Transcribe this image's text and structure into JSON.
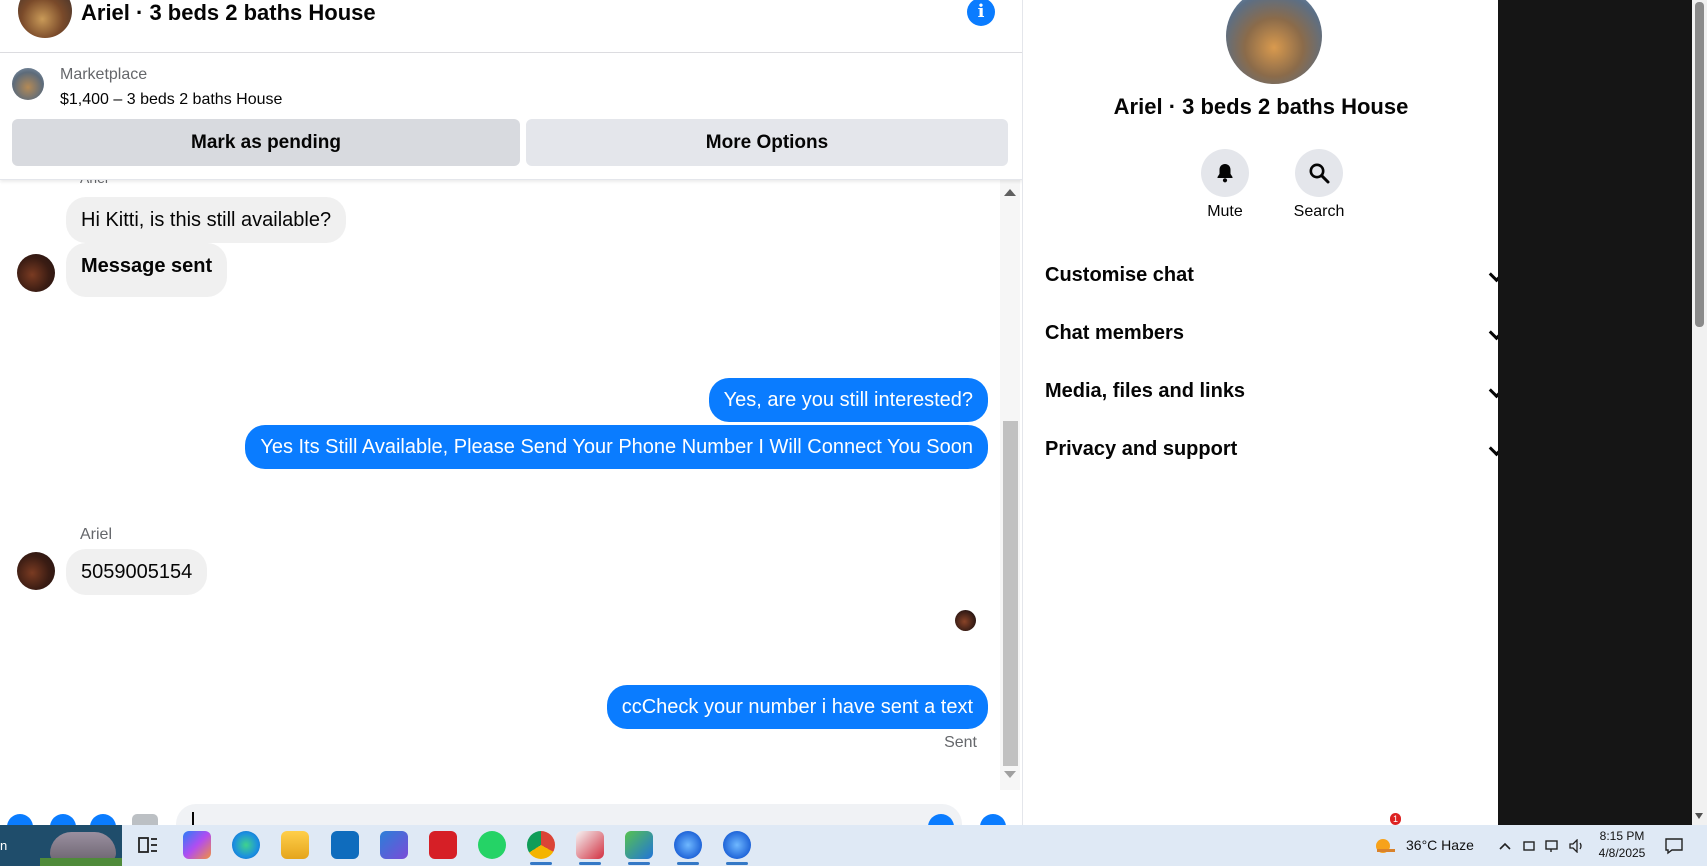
{
  "header": {
    "title": "Ariel · 3 beds 2 baths House"
  },
  "listing": {
    "source": "Marketplace",
    "price_line": "$1,400 – 3 beds 2 baths House",
    "pending_label": "Mark as pending",
    "more_label": "More Options"
  },
  "messages": {
    "cut_sender": "Ariel",
    "in_1": "Hi Kitti, is this still available?",
    "in_2": "Message sent",
    "out_1": "Yes, are you still interested?",
    "out_2": "Yes Its Still Available, Please Send Your Phone Number I Will Connect You Soon",
    "sender_2": "Ariel",
    "in_3": "5059005154",
    "out_3": "ccCheck your number i have sent a text",
    "status": "Sent"
  },
  "details": {
    "name": "Ariel · 3 beds 2 baths House",
    "mute_label": "Mute",
    "search_label": "Search",
    "sections": [
      "Customise chat",
      "Chat members",
      "Media, files and links",
      "Privacy and support"
    ]
  },
  "taskbar": {
    "search_edge": "n",
    "weather_badge": "1",
    "weather": "36°C  Haze",
    "time": "8:15 PM",
    "date": "4/8/2025"
  },
  "colors": {
    "messenger_blue": "#0a7cff",
    "bubble_gray": "#f0f0f0",
    "button_gray": "#e4e6eb"
  }
}
